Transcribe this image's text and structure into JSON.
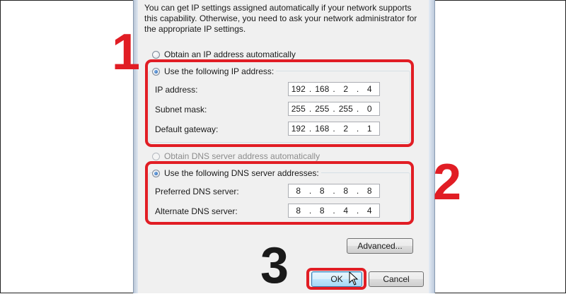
{
  "description": "You can get IP settings assigned automatically if your network supports this capability. Otherwise, you need to ask your network administrator for the appropriate IP settings.",
  "ip_section": {
    "auto_label": "Obtain an IP address automatically",
    "manual_label": "Use the following IP address:",
    "fields": [
      {
        "label": "IP address:",
        "octets": [
          "192",
          "168",
          "2",
          "4"
        ]
      },
      {
        "label": "Subnet mask:",
        "octets": [
          "255",
          "255",
          "255",
          "0"
        ]
      },
      {
        "label": "Default gateway:",
        "octets": [
          "192",
          "168",
          "2",
          "1"
        ]
      }
    ]
  },
  "dns_section": {
    "auto_label": "Obtain DNS server address automatically",
    "manual_label": "Use the following DNS server addresses:",
    "fields": [
      {
        "label": "Preferred DNS server:",
        "octets": [
          "8",
          "8",
          "8",
          "8"
        ]
      },
      {
        "label": "Alternate DNS server:",
        "octets": [
          "8",
          "8",
          "4",
          "4"
        ]
      }
    ]
  },
  "buttons": {
    "advanced": "Advanced...",
    "ok": "OK",
    "cancel": "Cancel"
  },
  "annotations": {
    "step1": "1",
    "step2": "2",
    "step3": "3"
  },
  "colors": {
    "annotation_red": "#e11d24",
    "dialog_bg": "#f0f0f0"
  }
}
